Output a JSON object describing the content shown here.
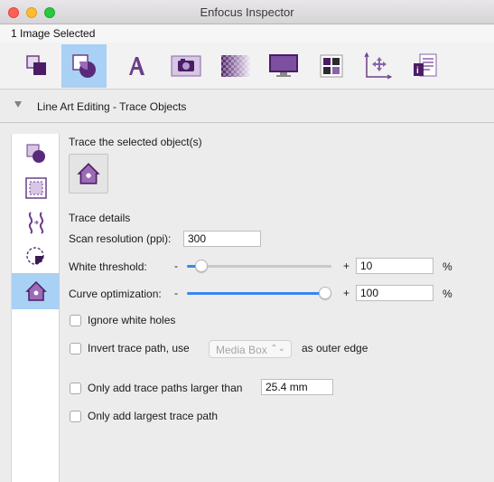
{
  "window": {
    "title": "Enfocus Inspector"
  },
  "selection": {
    "label": "1 Image Selected"
  },
  "toolbar": {
    "items": [
      {
        "name": "object-icon",
        "active": false
      },
      {
        "name": "image-icon",
        "active": true
      },
      {
        "name": "text-icon",
        "active": false
      },
      {
        "name": "camera-icon",
        "active": false
      },
      {
        "name": "gradient-icon",
        "active": false
      },
      {
        "name": "monitor-icon",
        "active": false
      },
      {
        "name": "color-swatch-icon",
        "active": false
      },
      {
        "name": "axes-move-icon",
        "active": false
      },
      {
        "name": "document-info-icon",
        "active": false
      }
    ]
  },
  "section": {
    "title": "Line Art Editing - Trace Objects"
  },
  "sidebar": {
    "items": [
      {
        "name": "shape-icon",
        "active": false
      },
      {
        "name": "crop-icon",
        "active": false
      },
      {
        "name": "wave-icon",
        "active": false
      },
      {
        "name": "circle-cut-icon",
        "active": false
      },
      {
        "name": "trace-house-icon",
        "active": true
      }
    ]
  },
  "trace": {
    "heading": "Trace the selected object(s)",
    "details_heading": "Trace details",
    "scan_resolution_label": "Scan resolution (ppi):",
    "scan_resolution_value": "300",
    "white_threshold_label": "White threshold:",
    "white_threshold_minus": "-",
    "white_threshold_plus": "+",
    "white_threshold_value": "10",
    "white_threshold_level": 0.1,
    "white_threshold_unit": "%",
    "curve_label": "Curve optimization:",
    "curve_minus": "-",
    "curve_plus": "+",
    "curve_value": "100",
    "curve_level": 1.0,
    "curve_unit": "%",
    "ignore_white_holes": {
      "label": "Ignore white holes",
      "checked": false
    },
    "invert_trace": {
      "label": "Invert trace path, use",
      "checked": false,
      "dropdown": "Media Box",
      "suffix": "as outer edge"
    },
    "only_larger": {
      "label": "Only add trace paths larger than",
      "checked": false,
      "value": "25.4 mm"
    },
    "only_largest": {
      "label": "Only add largest trace path",
      "checked": false
    }
  },
  "colors": {
    "accent_blue": "#3a86f0",
    "selected_bg": "#a9d0f5",
    "icon_purple": "#7b3a96"
  }
}
